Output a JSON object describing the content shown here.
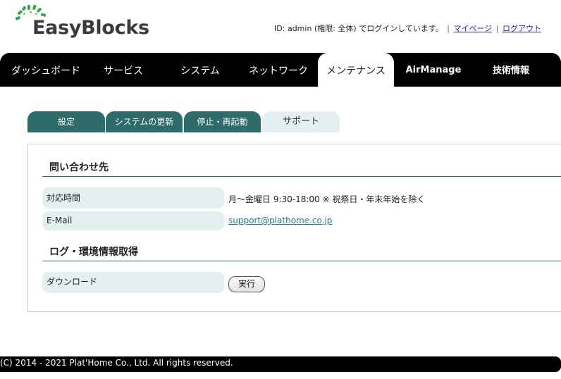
{
  "header": {
    "logo_text": "EasyBlocks",
    "user_info": "ID: admin (権限: 全体) でログインしています。",
    "mypage_link": "マイページ",
    "logout_link": "ログアウト",
    "separator": "|"
  },
  "mainnav": {
    "items": [
      {
        "label": "ダッシュボード"
      },
      {
        "label": "サービス"
      },
      {
        "label": "システム"
      },
      {
        "label": "ネットワーク"
      },
      {
        "label": "メンテナンス"
      },
      {
        "label": "AirManage"
      },
      {
        "label": "技術情報"
      }
    ],
    "active_index": 4
  },
  "subtabs": {
    "items": [
      {
        "label": "設定"
      },
      {
        "label": "システムの更新"
      },
      {
        "label": "停止・再起動"
      },
      {
        "label": "サポート"
      }
    ],
    "active_index": 3
  },
  "contact": {
    "section_title": "問い合わせ先",
    "hours_label": "対応時間",
    "hours_value": "月～金曜日 9:30-18:00 ※ 祝祭日・年末年始を除く",
    "email_label": "E-Mail",
    "email_value": "support@plathome.co.jp"
  },
  "log": {
    "section_title": "ログ・環境情報取得",
    "download_label": "ダウンロード",
    "execute_button": "実行"
  },
  "footer": {
    "copyright": "(C) 2014 - 2021 Plat'Home Co., Ltd. All rights reserved."
  },
  "colors": {
    "tab_dark": "#2e6b6b",
    "tab_light": "#e3f0ef",
    "nav_bg": "#000000",
    "link": "#3a1e9a"
  }
}
